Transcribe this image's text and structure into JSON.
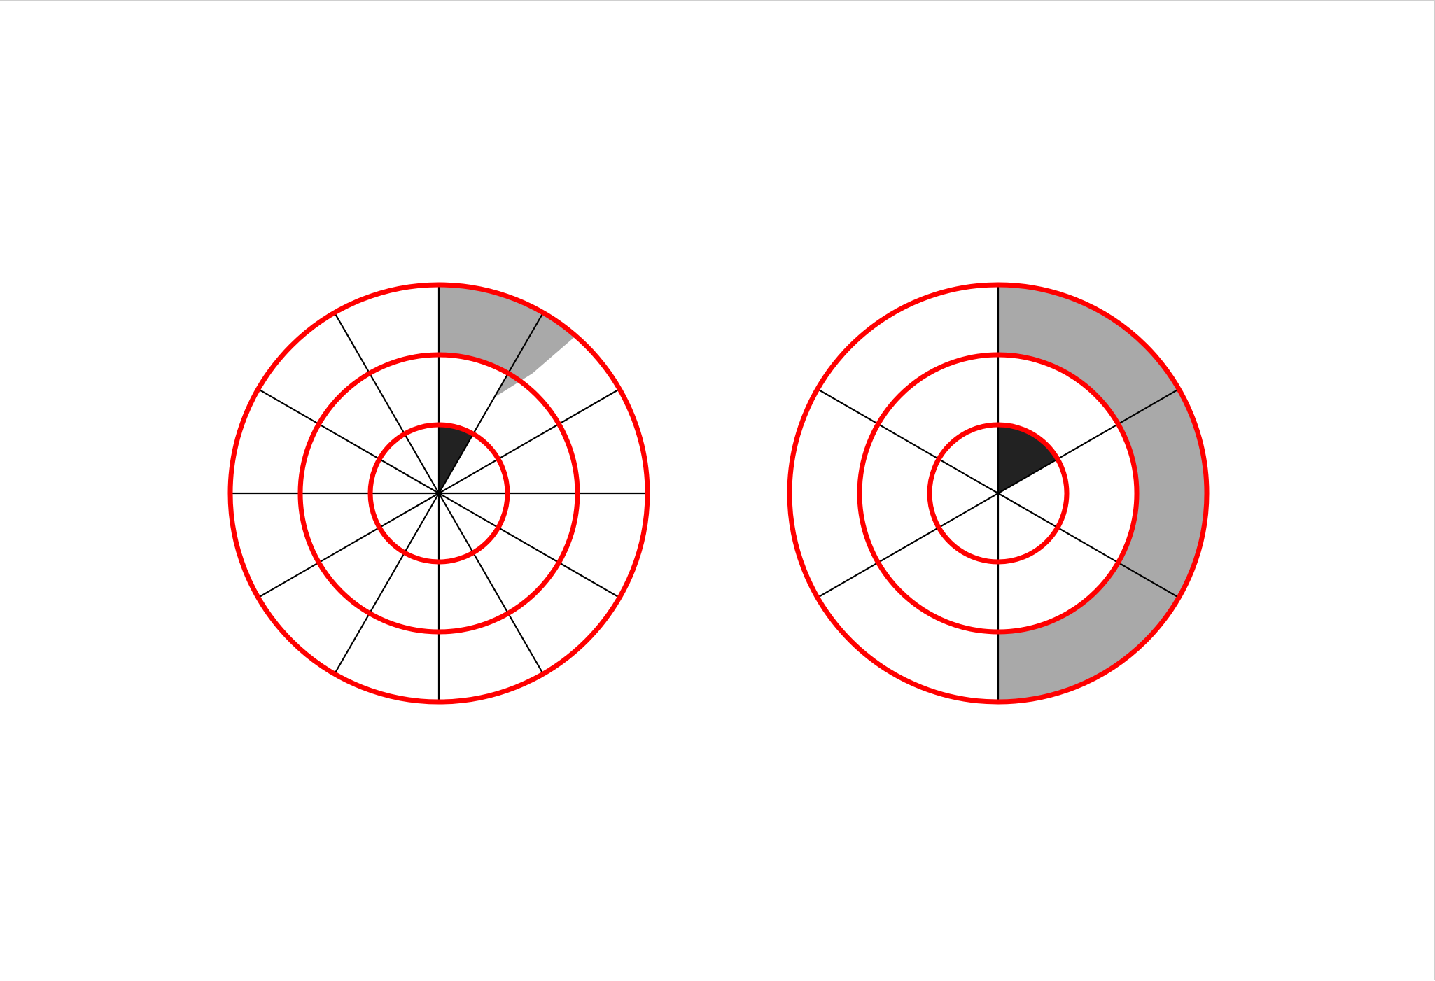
{
  "colors": {
    "background": "#ffffff",
    "ring": "#ff0000",
    "spoke": "#000000",
    "outer_highlight": "#a9a9a9",
    "inner_highlight": "#222222"
  },
  "diagrams": [
    {
      "id": "left",
      "divisions": 12,
      "rings": 3,
      "highlights": [
        {
          "ring": 3,
          "start_deg": 0,
          "end_deg": 30,
          "color": "outer_highlight"
        },
        {
          "ring": 3,
          "start_deg": 30,
          "end_deg": 41,
          "color": "outer_highlight",
          "partial": "wedge"
        },
        {
          "ring": 1,
          "start_deg": 0,
          "end_deg": 30,
          "color": "inner_highlight"
        }
      ]
    },
    {
      "id": "right",
      "divisions": 6,
      "rings": 3,
      "highlights": [
        {
          "ring": 3,
          "start_deg": 0,
          "end_deg": 180,
          "color": "outer_highlight"
        },
        {
          "ring": 1,
          "start_deg": 0,
          "end_deg": 60,
          "color": "inner_highlight"
        }
      ]
    }
  ]
}
